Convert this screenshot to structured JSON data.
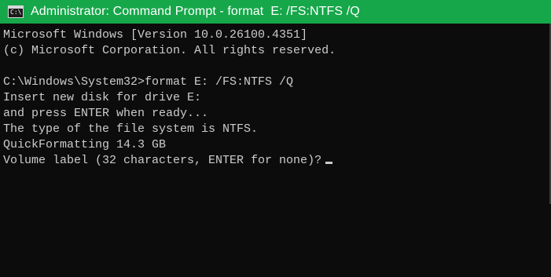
{
  "window": {
    "title": "Administrator: Command Prompt - format  E: /FS:NTFS /Q",
    "icon": "command-prompt-icon",
    "icon_glyph": "C:\\",
    "titlebar_color": "#16a74a",
    "background_color": "#0c0c0c",
    "text_color": "#cccccc"
  },
  "console": {
    "lines": [
      "Microsoft Windows [Version 10.0.26100.4351]",
      "(c) Microsoft Corporation. All rights reserved.",
      "",
      "C:\\Windows\\System32>format E: /FS:NTFS /Q",
      "Insert new disk for drive E:",
      "and press ENTER when ready...",
      "The type of the file system is NTFS.",
      "QuickFormatting 14.3 GB",
      "Volume label (32 characters, ENTER for none)?"
    ]
  }
}
